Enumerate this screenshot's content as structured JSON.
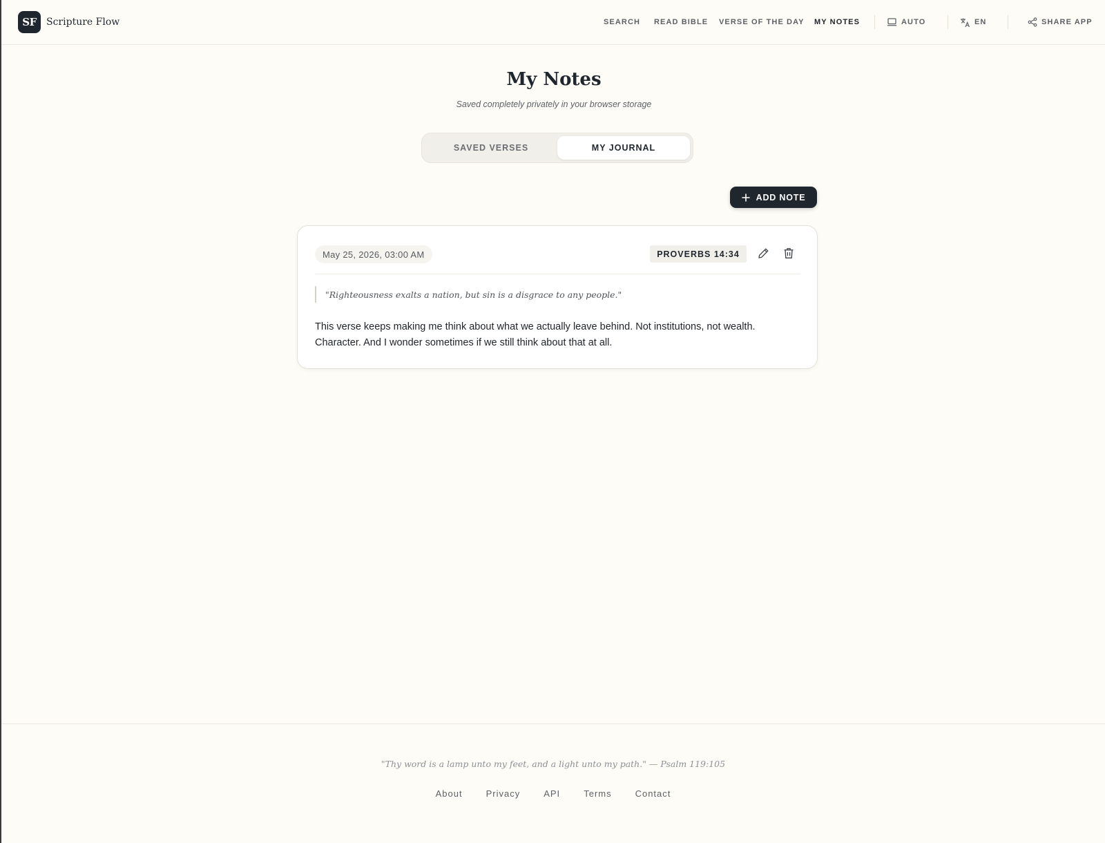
{
  "brand": {
    "logo_text": "SF",
    "name": "Scripture Flow"
  },
  "nav": {
    "search": "SEARCH",
    "read_bible": "READ BIBLE",
    "verse_of_the_day": "VERSE OF THE DAY",
    "my_notes": "MY NOTES",
    "theme": "AUTO",
    "language": "EN",
    "share": "SHARE APP"
  },
  "page": {
    "title": "My Notes",
    "subtitle": "Saved completely privately in your browser storage"
  },
  "tabs": [
    {
      "label": "SAVED VERSES",
      "active": false
    },
    {
      "label": "MY JOURNAL",
      "active": true
    }
  ],
  "add_note_label": "ADD NOTE",
  "notes": [
    {
      "date": "May 25, 2026, 03:00 AM",
      "reference": "PROVERBS 14:34",
      "quote": "\"Righteousness exalts a nation, but sin is a disgrace to any people.\"",
      "body": "This verse keeps making me think about what we actually leave behind. Not institutions, not wealth. Character. And I wonder sometimes if we still think about that at all."
    }
  ],
  "footer": {
    "quote": "\"Thy word is a lamp unto my feet, and a light unto my path.\" — Psalm 119:105",
    "links": [
      "About",
      "Privacy",
      "API",
      "Terms",
      "Contact"
    ]
  },
  "icons": {
    "theme": "laptop-icon",
    "language": "translate-icon",
    "share": "share-icon",
    "add": "plus-icon",
    "edit": "pencil-icon",
    "delete": "trash-icon"
  },
  "colors": {
    "background": "#fdfcf7",
    "primary": "#1f262e",
    "muted": "#5d6166"
  }
}
